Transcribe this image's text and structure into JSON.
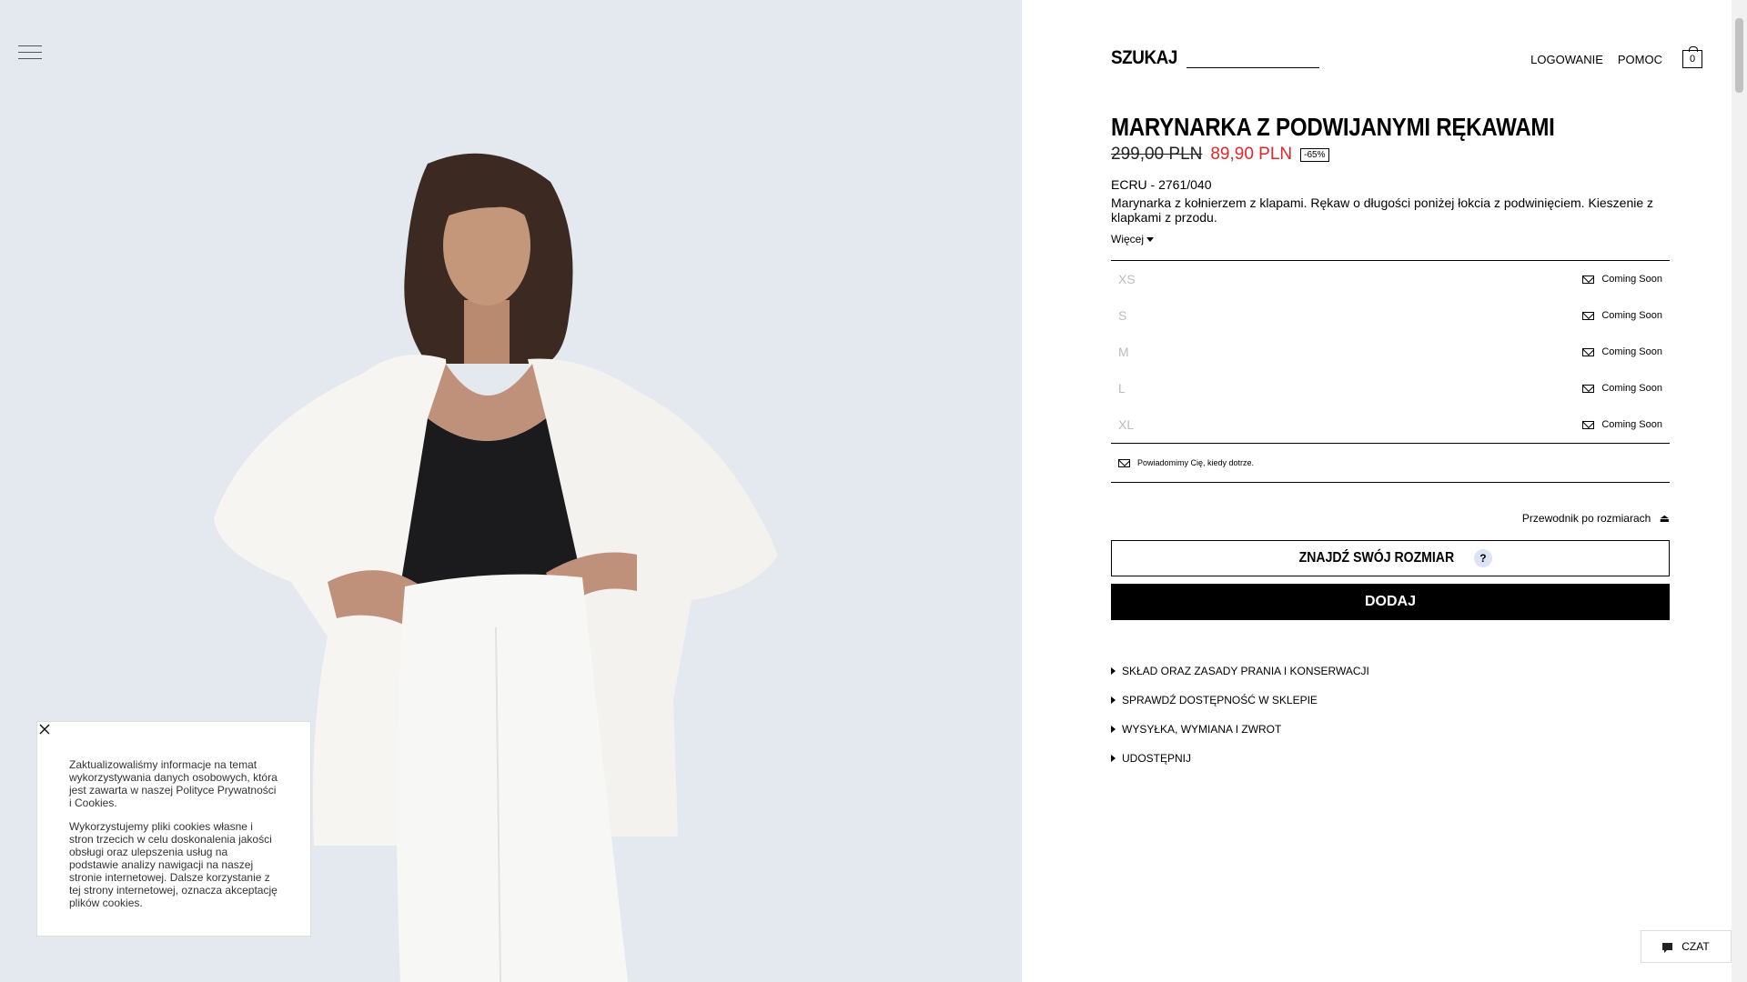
{
  "header": {
    "search_label": "SZUKAJ",
    "login": "LOGOWANIE",
    "help": "POMOC",
    "bag_count": "0"
  },
  "product": {
    "title": "MARYNARKA Z PODWIJANYMI RĘKAWAMI",
    "old_price": "299,00 PLN",
    "new_price": "89,90 PLN",
    "discount": "-65%",
    "color_ref": "ECRU - 2761/040",
    "description": "Marynarka z kołnierzem z klapami. Rękaw o długości poniżej łokcia z podwinięciem. Kieszenie z klapkami z przodu.",
    "more": "Więcej"
  },
  "sizes": [
    {
      "name": "XS",
      "status": "Coming Soon"
    },
    {
      "name": "S",
      "status": "Coming Soon"
    },
    {
      "name": "M",
      "status": "Coming Soon"
    },
    {
      "name": "L",
      "status": "Coming Soon"
    },
    {
      "name": "XL",
      "status": "Coming Soon"
    }
  ],
  "notify_text": "Powiadomimy Cię, kiedy dotrze.",
  "size_guide": "Przewodnik po rozmiarach",
  "find_size_button": "ZNAJDŹ SWÓJ ROZMIAR",
  "find_size_help": "?",
  "add_button": "DODAJ",
  "accordion": [
    "SKŁAD ORAZ ZASADY PRANIA I KONSERWACJI",
    "SPRAWDŹ DOSTĘPNOŚĆ W SKLEPIE",
    "WYSYŁKA, WYMIANA I ZWROT",
    "UDOSTĘPNIJ"
  ],
  "cookie": {
    "p1": "Zaktualizowaliśmy informacje na temat wykorzystywania danych osobowych, która jest zawarta w naszej Polityce Prywatności i Cookies.",
    "p2": "Wykorzystujemy pliki cookies własne i stron trzecich w celu doskonalenia jakości obsługi oraz ulepszenia usług na podstawie analizy nawigacji na naszej stronie internetowej. Dalsze korzystanie z tej strony internetowej, oznacza akceptację plików cookies."
  },
  "chat_label": "CZAT"
}
